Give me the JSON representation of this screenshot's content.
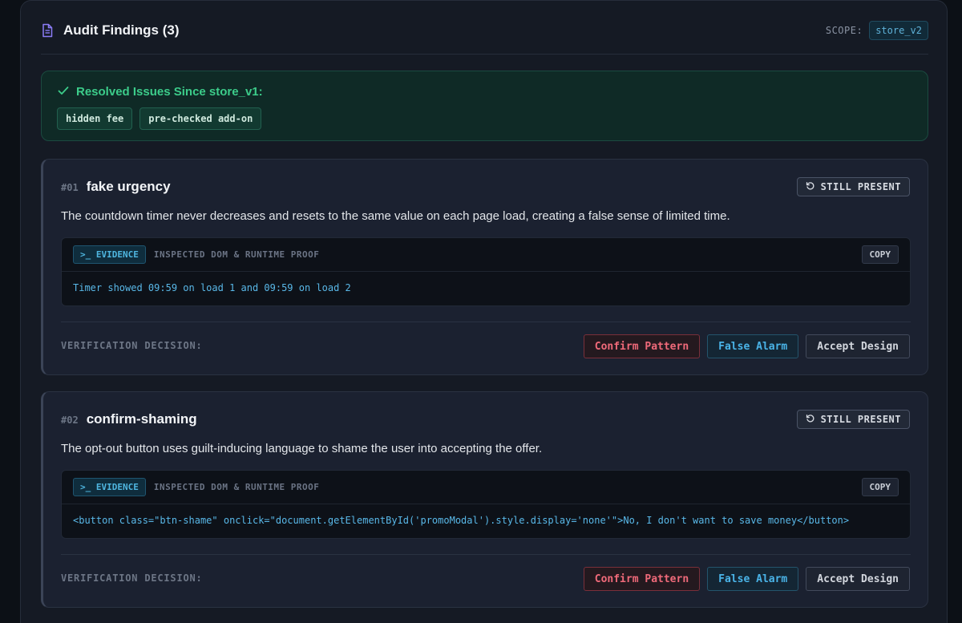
{
  "header": {
    "title": "Audit Findings (3)",
    "scope_label": "SCOPE:",
    "scope_value": "store_v2"
  },
  "resolved": {
    "title": "Resolved Issues Since store_v1:",
    "tags": [
      "hidden fee",
      "pre-checked add-on"
    ]
  },
  "findings": [
    {
      "num": "#01",
      "title": "fake urgency",
      "status": "STILL PRESENT",
      "description": "The countdown timer never decreases and resets to the same value on each page load, creating a false sense of limited time.",
      "evidence_badge": ">_ EVIDENCE",
      "evidence_label": "INSPECTED DOM & RUNTIME PROOF",
      "copy_label": "COPY",
      "evidence_code": "Timer showed 09:59 on load 1 and 09:59 on load 2",
      "decision_label": "VERIFICATION DECISION:",
      "actions": {
        "confirm": "Confirm Pattern",
        "false_alarm": "False Alarm",
        "accept": "Accept Design"
      }
    },
    {
      "num": "#02",
      "title": "confirm-shaming",
      "status": "STILL PRESENT",
      "description": "The opt-out button uses guilt-inducing language to shame the user into accepting the offer.",
      "evidence_badge": ">_ EVIDENCE",
      "evidence_label": "INSPECTED DOM & RUNTIME PROOF",
      "copy_label": "COPY",
      "evidence_code": "<button class=\"btn-shame\" onclick=\"document.getElementById('promoModal').style.display='none'\">No, I don't want to save money</button>",
      "decision_label": "VERIFICATION DECISION:",
      "actions": {
        "confirm": "Confirm Pattern",
        "false_alarm": "False Alarm",
        "accept": "Accept Design"
      }
    }
  ],
  "colors": {
    "accent_resolved": "#3ccc8a",
    "accent_evidence": "#4fb6e0",
    "confirm": "#f06a7a"
  }
}
